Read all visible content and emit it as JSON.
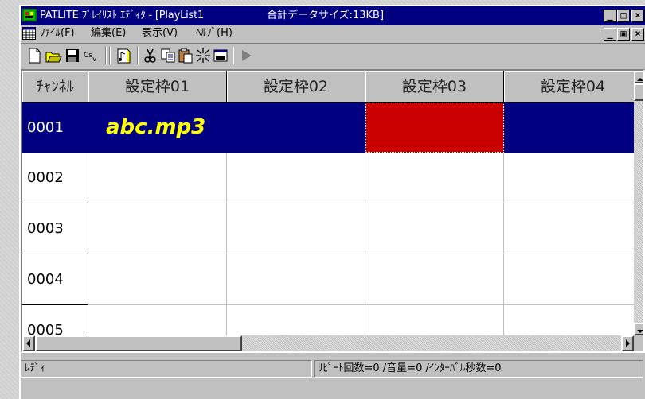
{
  "window": {
    "title": "PATLITE ﾌﾟﾚｲﾘｽﾄ ｴﾃﾞｨﾀ - [PlayList1",
    "data_size": "合計データサイズ:13KB]",
    "minimize_glyph": "_",
    "maximize_glyph": "□",
    "close_glyph": "×",
    "restore_glyph": "▣"
  },
  "menu": {
    "items": [
      "ﾌｧｲﾙ(F)",
      "編集(E)",
      "表示(V)",
      "ﾍﾙﾌﾟ(H)"
    ]
  },
  "toolbar": {
    "icons": [
      "new-icon",
      "open-icon",
      "save-icon",
      "csv-icon",
      "playlist-icon",
      "cut-icon",
      "copy-icon",
      "paste-icon",
      "clear-icon",
      "window-icon",
      "play-icon"
    ],
    "csv_label": "CSV"
  },
  "grid": {
    "headers": [
      "ﾁｬﾝﾈﾙ",
      "設定枠01",
      "設定枠02",
      "設定枠03",
      "設定枠04"
    ],
    "rows": [
      {
        "channel": "0001",
        "slot01": "abc.mp3"
      },
      {
        "channel": "0002",
        "slot01": ""
      },
      {
        "channel": "0003",
        "slot01": ""
      },
      {
        "channel": "0004",
        "slot01": ""
      },
      {
        "channel": "0005",
        "slot01": ""
      }
    ],
    "selected_row": "0001",
    "colors": {
      "selected": "#000080",
      "red_cell": "#c80000",
      "file_text": "#ffff00"
    }
  },
  "status": {
    "left": "ﾚﾃﾞｨ",
    "right": "ﾘﾋﾟｰﾄ回数=0 /音量=0 /ｲﾝﾀｰﾊﾞﾙ秒数=0"
  }
}
